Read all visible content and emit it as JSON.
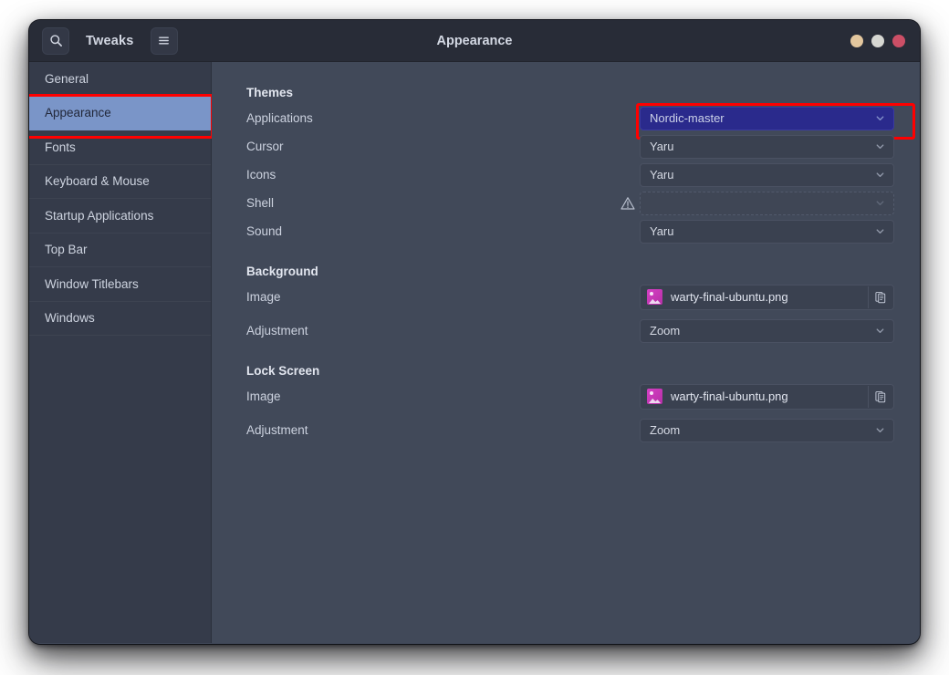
{
  "window": {
    "app_name": "Tweaks",
    "title": "Appearance",
    "search_icon": "search-icon",
    "menu_icon": "hamburger-menu-icon",
    "controls": [
      {
        "name": "minimize-button",
        "color": "#e3c79e"
      },
      {
        "name": "maximize-button",
        "color": "#d6d7d2"
      },
      {
        "name": "close-button",
        "color": "#cc4f66"
      }
    ]
  },
  "sidebar": {
    "items": [
      {
        "label": "General",
        "selected": false
      },
      {
        "label": "Appearance",
        "selected": true
      },
      {
        "label": "Fonts",
        "selected": false
      },
      {
        "label": "Keyboard & Mouse",
        "selected": false
      },
      {
        "label": "Startup Applications",
        "selected": false
      },
      {
        "label": "Top Bar",
        "selected": false
      },
      {
        "label": "Window Titlebars",
        "selected": false
      },
      {
        "label": "Windows",
        "selected": false
      }
    ]
  },
  "content": {
    "themes": {
      "heading": "Themes",
      "rows": [
        {
          "label": "Applications",
          "value": "Nordic-master",
          "state": "highlighted",
          "warning": false
        },
        {
          "label": "Cursor",
          "value": "Yaru",
          "state": "normal",
          "warning": false
        },
        {
          "label": "Icons",
          "value": "Yaru",
          "state": "normal",
          "warning": false
        },
        {
          "label": "Shell",
          "value": "",
          "state": "disabled",
          "warning": true
        },
        {
          "label": "Sound",
          "value": "Yaru",
          "state": "normal",
          "warning": false
        }
      ]
    },
    "background": {
      "heading": "Background",
      "image_label": "Image",
      "image_value": "warty-final-ubuntu.png",
      "adjustment_label": "Adjustment",
      "adjustment_value": "Zoom"
    },
    "lock_screen": {
      "heading": "Lock Screen",
      "image_label": "Image",
      "image_value": "warty-final-ubuntu.png",
      "adjustment_label": "Adjustment",
      "adjustment_value": "Zoom"
    }
  },
  "icons": {
    "warning": "warning-triangle-icon",
    "thumbnail": "image-thumbnail-icon",
    "copy": "copy-document-icon",
    "chevron": "chevron-down-icon"
  },
  "colors": {
    "accent_selection": "#7a95c8",
    "highlight_box": "#ff0000",
    "combo_selected": "#2a2a8c",
    "sidebar_bg": "#353b4a",
    "content_bg": "#414959",
    "titlebar_bg": "#282c37"
  }
}
